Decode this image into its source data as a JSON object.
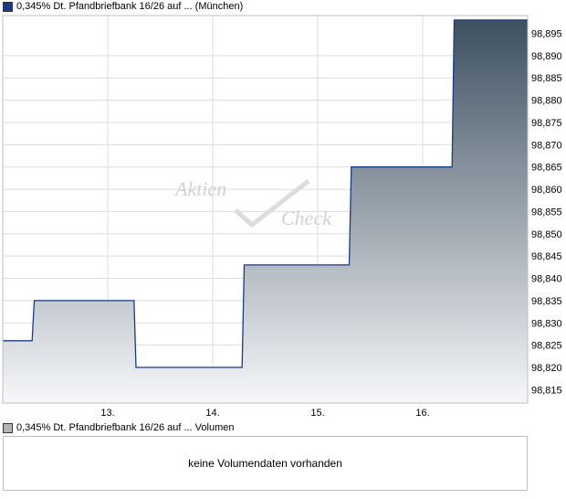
{
  "legend": {
    "price_label": "0,345% Dt. Pfandbriefbank 16/26 auf ... (München)",
    "price_color": "#1a3a8a",
    "volume_label": "0,345% Dt. Pfandbriefbank 16/26 auf ... Volumen",
    "volume_color": "#b4b4b4"
  },
  "watermark": {
    "line1": "Aktien",
    "line2": "Check"
  },
  "volume": {
    "message": "keine Volumendaten vorhanden"
  },
  "chart_data": {
    "type": "area",
    "x_tick_labels": [
      "13.",
      "14.",
      "15.",
      "16."
    ],
    "x_tick_positions": [
      13,
      14,
      15,
      16
    ],
    "xlim": [
      12,
      17
    ],
    "ylim": [
      98.812,
      98.899
    ],
    "y_ticks": [
      98.815,
      98.82,
      98.825,
      98.83,
      98.835,
      98.84,
      98.845,
      98.85,
      98.855,
      98.86,
      98.865,
      98.87,
      98.875,
      98.88,
      98.885,
      98.89
    ],
    "y_tick_labels": [
      "98,815",
      "98,820",
      "98,825",
      "98,830",
      "98,835",
      "98,840",
      "98,845",
      "98,850",
      "98,855",
      "98,860",
      "98,865",
      "98,870",
      "98,875",
      "98,880",
      "98,885",
      "98,890",
      "98,895"
    ],
    "y_axis_side": "right",
    "grid": true,
    "line_color": "#1a3a8a",
    "fill_top_color": "#3d5060",
    "fill_bottom_color": "#f6f7f9",
    "series": [
      {
        "x": [
          12.0,
          12.28,
          12.3,
          13.25,
          13.27,
          14.28,
          14.3,
          15.3,
          15.32,
          16.28,
          16.3,
          17.0
        ],
        "values": [
          98.826,
          98.826,
          98.835,
          98.835,
          98.82,
          98.82,
          98.843,
          98.843,
          98.865,
          98.865,
          98.898,
          98.898
        ]
      }
    ]
  }
}
